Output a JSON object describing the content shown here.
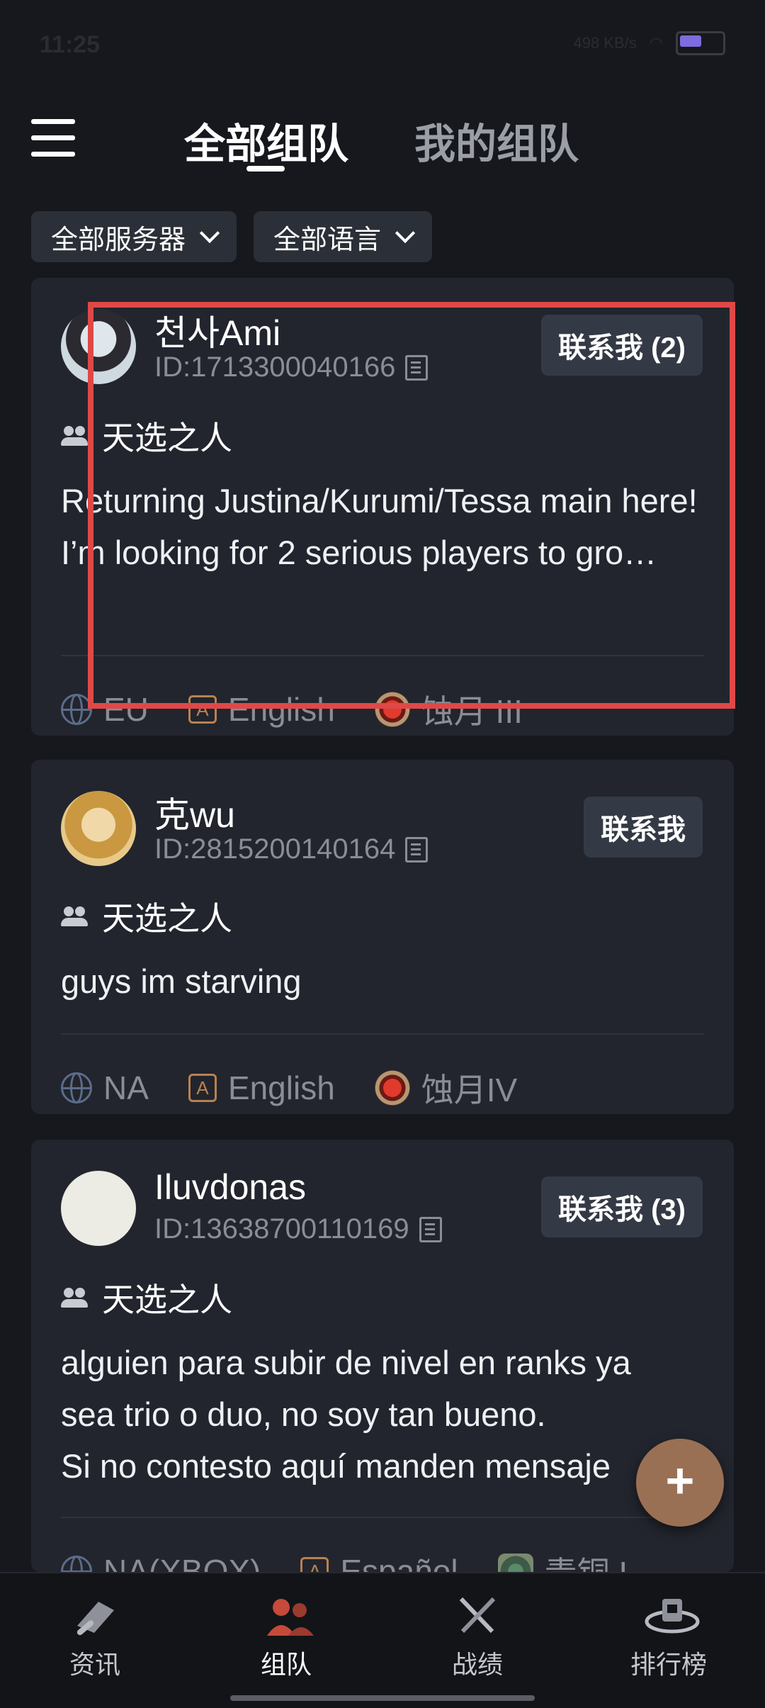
{
  "status": {
    "time": "11:25",
    "net_speed": "498",
    "net_unit": "KB/s"
  },
  "header": {
    "tabs": [
      {
        "label": "全部组队",
        "active": true
      },
      {
        "label": "我的组队",
        "active": false
      }
    ]
  },
  "filters": {
    "server": "全部服务器",
    "language": "全部语言"
  },
  "posts": [
    {
      "name": "천사Ami",
      "id": "ID:1713300040166",
      "contact": "联系我 (2)",
      "group": "天选之人",
      "message": "Returning Justina/Kurumi/Tessa main here!\nI’m looking for 2 serious players to gro…",
      "region": "EU",
      "language": "English",
      "rank": "蚀月 III"
    },
    {
      "name": "克wu",
      "id": "ID:2815200140164",
      "contact": "联系我",
      "group": "天选之人",
      "message": "guys im starving",
      "region": "NA",
      "language": "English",
      "rank": "蚀月IV"
    },
    {
      "name": "Iluvdonas",
      "id": "ID:13638700110169",
      "contact": "联系我 (3)",
      "group": "天选之人",
      "message": "alguien para subir de nivel en ranks ya sea trio o duo, no soy tan bueno.\nSi no contesto aquí manden mensaje",
      "region": "NA(XBOX)",
      "language": "Español",
      "rank": "青铜 I"
    }
  ],
  "fab": {
    "label": "+"
  },
  "nav": [
    {
      "label": "资讯",
      "icon": "news-scroll-icon",
      "active": false
    },
    {
      "label": "组队",
      "icon": "team-icon",
      "active": true
    },
    {
      "label": "战绩",
      "icon": "crossed-swords-icon",
      "active": false
    },
    {
      "label": "排行榜",
      "icon": "trophy-icon",
      "active": false
    }
  ],
  "colors": {
    "background": "#16181d",
    "card": "#22252d",
    "button": "#343a45",
    "fab": "#9a7055",
    "highlight": "#e04848"
  }
}
